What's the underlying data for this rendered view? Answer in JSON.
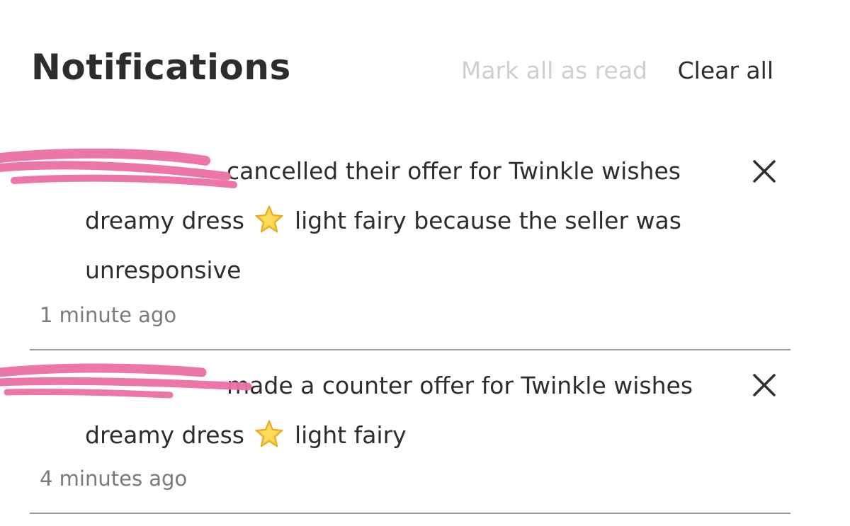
{
  "header": {
    "title": "Notifications",
    "mark_all_label": "Mark all as read",
    "clear_all_label": "Clear all"
  },
  "notifications": [
    {
      "username": "",
      "text_before_emoji": "cancelled their offer for Twinkle wishes dreamy dress",
      "emoji": "star",
      "text_after_emoji": "light fairy because the seller was unresponsive",
      "time": "1 minute ago"
    },
    {
      "username": "",
      "text_before_emoji": "made a counter offer for Twinkle wishes dreamy dress",
      "emoji": "star",
      "text_after_emoji": "light fairy",
      "time": "4 minutes ago"
    }
  ],
  "colors": {
    "text": "#2d2d2d",
    "muted_link": "#cfcfcf",
    "timestamp": "#7a7a7a",
    "divider": "#9a9a9a",
    "redaction": "#ec6fa4",
    "star": "#f7c331"
  },
  "icons": {
    "close": "close-icon",
    "emoji": "star-emoji-icon"
  }
}
